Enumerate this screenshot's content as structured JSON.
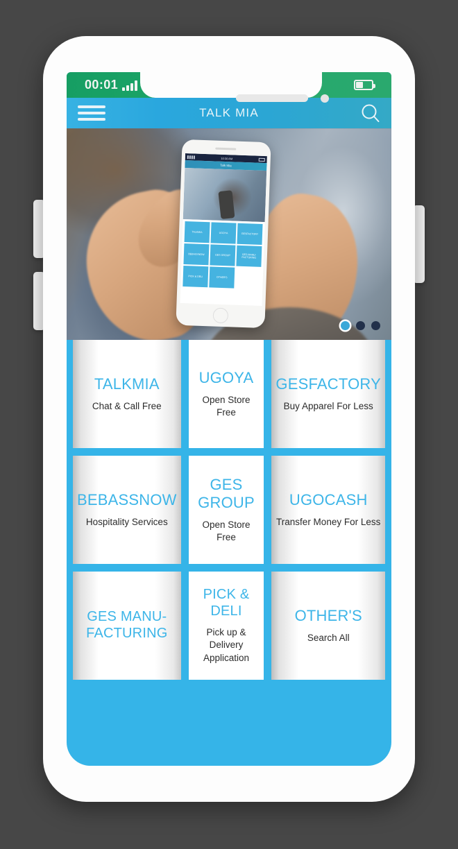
{
  "statusbar": {
    "clock": "00:01",
    "signal_icon": "signal-bars-icon",
    "battery_icon": "battery-icon",
    "battery_level_pct": 40
  },
  "appbar": {
    "title": "TALK MIA",
    "menu_icon": "hamburger-menu-icon",
    "search_icon": "search-icon"
  },
  "hero": {
    "alt": "hands holding white smartphone showing the Talk Mia app",
    "dots": [
      {
        "state": "active"
      },
      {
        "state": "idle"
      },
      {
        "state": "idle"
      }
    ],
    "mini_phone": {
      "status_time": "10:30 AM",
      "appbar_title": "Talk Mia",
      "tiles": [
        "TALKMIA",
        "UGOYA",
        "GESFACTORY",
        "BEBASSNOW",
        "GES GROUP",
        "GES MANU-FACTURING",
        "PICK & DELI",
        "OTHER'S",
        ""
      ]
    }
  },
  "grid": {
    "tiles": [
      {
        "title": "TALKMIA",
        "subtitle": "Chat & Call Free",
        "shaded": true
      },
      {
        "title": "UGOYA",
        "subtitle": "Open Store Free",
        "shaded": false
      },
      {
        "title": "GESFACTORY",
        "subtitle": "Buy Apparel For Less",
        "shaded": true
      },
      {
        "title": "BEBASSNOW",
        "subtitle": "Hospitality Services",
        "shaded": true
      },
      {
        "title": "GES GROUP",
        "subtitle": "Open Store Free",
        "shaded": false
      },
      {
        "title": "UGOCASH",
        "subtitle": "Transfer Money For Less",
        "shaded": true
      },
      {
        "title": "GES MANU-FACTURING",
        "subtitle": "",
        "shaded": true
      },
      {
        "title": "PICK & DELI",
        "subtitle": "Pick up & Delivery Application",
        "shaded": false
      },
      {
        "title": "OTHER'S",
        "subtitle": "Search All",
        "shaded": true
      }
    ]
  },
  "colors": {
    "page_background": "#474747",
    "phone_body": "#fdfdfd",
    "screen_blue": "#35b4e8",
    "appbar_blue": "#2ba7dc",
    "statusbar_green": "#1da567",
    "tile_title_blue": "#3db5e8",
    "tile_subtitle": "#2b2b2b",
    "dot_active": "#3aa8d8",
    "dot_idle": "#22304a"
  }
}
